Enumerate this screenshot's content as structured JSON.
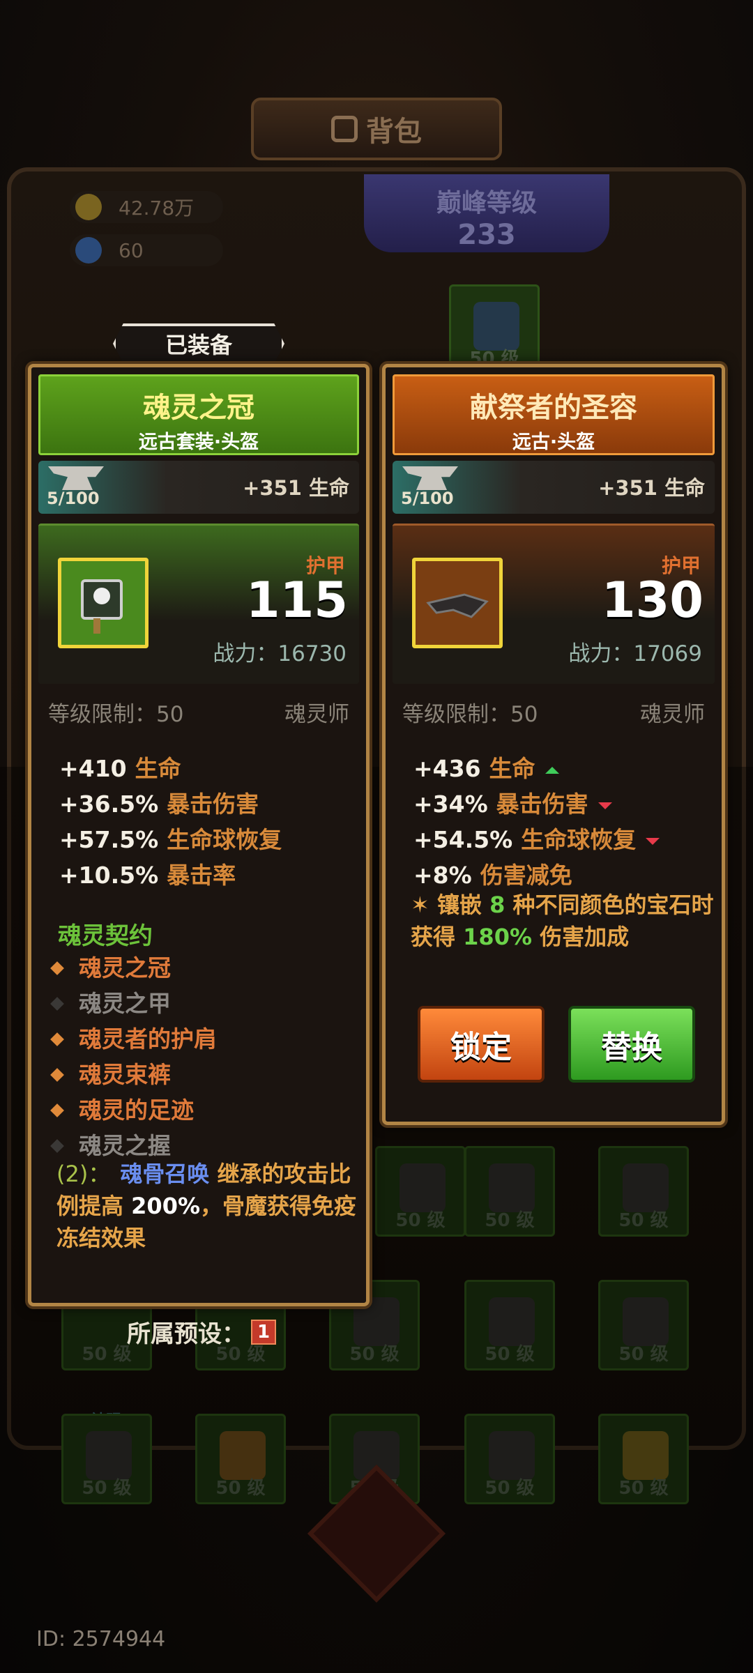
{
  "header": {
    "title": "背包"
  },
  "resources": {
    "gold": "42.78万",
    "gems": "60"
  },
  "peak_level": {
    "label": "巅峰等级",
    "value": "233"
  },
  "equipped_tag": "已装备",
  "grid": {
    "shen_label": "神赐",
    "level_label": "50 级"
  },
  "left_card": {
    "name": "魂灵之冠",
    "subtitle": "远古套装·头盔",
    "forge": "5/100",
    "forge_bonus": "+351 生命",
    "armor_label": "护甲",
    "armor_value": "115",
    "power": "战力：16730",
    "level_limit": "等级限制：50",
    "class": "魂灵师",
    "stats": [
      {
        "v": "+410",
        "k": "生命"
      },
      {
        "v": "+36.5%",
        "k": "暴击伤害"
      },
      {
        "v": "+57.5%",
        "k": "生命球恢复"
      },
      {
        "v": "+10.5%",
        "k": "暴击率"
      }
    ],
    "set_title": "魂灵契约",
    "set_items": [
      {
        "name": "魂灵之冠",
        "owned": true
      },
      {
        "name": "魂灵之甲",
        "owned": false
      },
      {
        "name": "魂灵者的护肩",
        "owned": true
      },
      {
        "name": "魂灵束裤",
        "owned": true
      },
      {
        "name": "魂灵的足迹",
        "owned": true
      },
      {
        "name": "魂灵之握",
        "owned": false
      }
    ],
    "set_bonus": {
      "count": "(2)：",
      "name": "魂骨召唤",
      "text1": "继承的攻击比例提高",
      "pct": "200%",
      "text2": "，骨魔获得免疫冻结效果"
    }
  },
  "right_card": {
    "name": "献祭者的圣容",
    "subtitle": "远古·头盔",
    "forge": "5/100",
    "forge_bonus": "+351 生命",
    "armor_label": "护甲",
    "armor_value": "130",
    "power": "战力：17069",
    "level_limit": "等级限制：50",
    "class": "魂灵师",
    "stats": [
      {
        "v": "+436",
        "k": "生命",
        "trend": "up"
      },
      {
        "v": "+34%",
        "k": "暴击伤害",
        "trend": "down"
      },
      {
        "v": "+54.5%",
        "k": "生命球恢复",
        "trend": "down"
      },
      {
        "v": "+8%",
        "k": "伤害减免",
        "trend": "none"
      }
    ],
    "gem_text": {
      "a": "镶嵌",
      "n": "8",
      "b": "种不同颜色的宝石时获得",
      "pct": "180%",
      "c": "伤害加成"
    },
    "lock_label": "锁定",
    "swap_label": "替换"
  },
  "preset": {
    "label": "所属预设：",
    "value": "1"
  },
  "player_id": "ID: 2574944"
}
